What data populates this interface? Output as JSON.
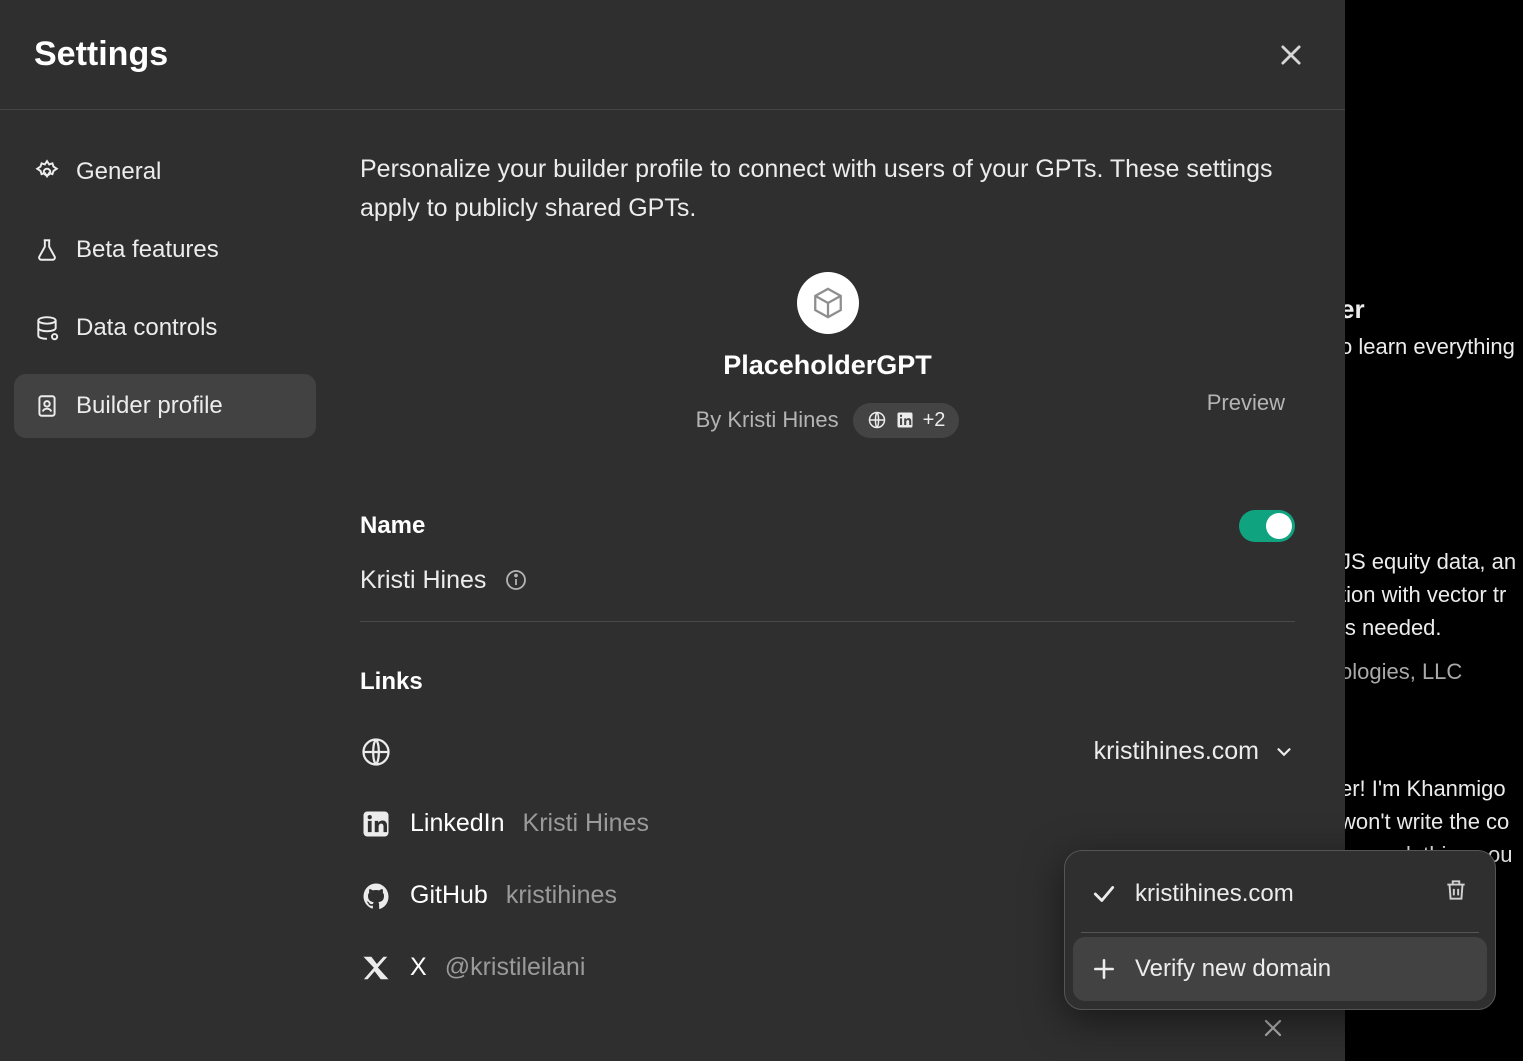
{
  "header": {
    "title": "Settings"
  },
  "sidebar": {
    "items": [
      {
        "label": "General"
      },
      {
        "label": "Beta features"
      },
      {
        "label": "Data controls"
      },
      {
        "label": "Builder profile"
      }
    ]
  },
  "content": {
    "intro": "Personalize your builder profile to connect with users of your GPTs. These settings apply to publicly shared GPTs.",
    "preview_label": "Preview",
    "profile": {
      "title": "PlaceholderGPT",
      "byline_prefix": "By",
      "byline_name": "Kristi Hines",
      "social_more": "+2"
    },
    "name": {
      "label": "Name",
      "value": "Kristi Hines",
      "toggle_on": true
    },
    "links": {
      "label": "Links",
      "website": {
        "domain": "kristihines.com"
      },
      "linkedin": {
        "label": "LinkedIn",
        "value": "Kristi Hines"
      },
      "github": {
        "label": "GitHub",
        "value": "kristihines"
      },
      "x": {
        "label": "X",
        "value": "@kristileilani"
      }
    }
  },
  "dropdown": {
    "selected_domain": "kristihines.com",
    "verify_label": "Verify new domain"
  },
  "background": {
    "l1": "er",
    "l2": "o learn everything",
    "l3": "JS equity data, an",
    "l4": "tion with vector tr",
    "l5": "is needed.",
    "l6": "ologies, LLC",
    "l7": "er! I'm Khanmigo",
    "l8": "won't write the co",
    "l9": "ou work things ou"
  }
}
